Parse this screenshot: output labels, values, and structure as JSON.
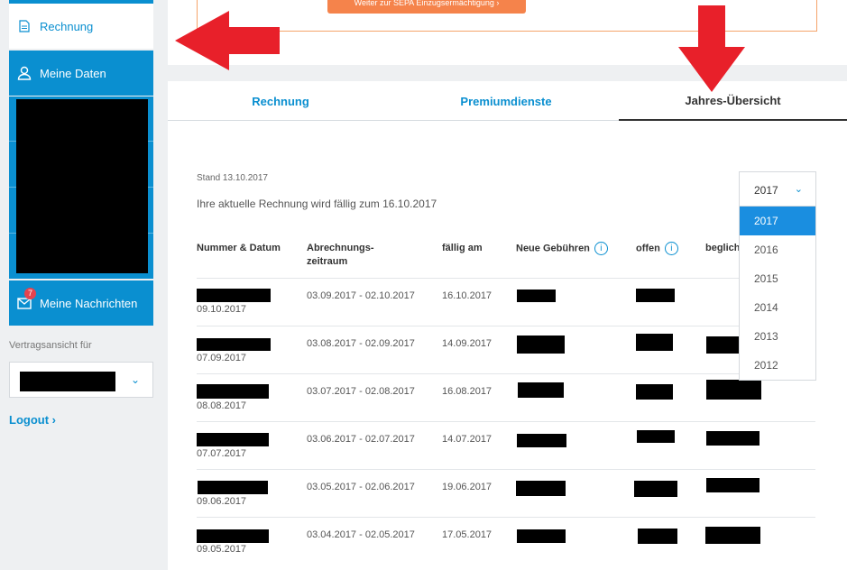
{
  "sidebar": {
    "items": [
      {
        "label": "Rechnung",
        "icon": "document-icon"
      },
      {
        "label": "Meine Daten",
        "icon": "user-icon"
      },
      {
        "label": "Meine Nachrichten",
        "icon": "envelope-icon",
        "badge": "7"
      }
    ],
    "contract_label": "Vertragsansicht für",
    "logout": "Logout ›"
  },
  "banner": {
    "button_label": "Weiter zur SEPA Einzugsermächtigung ›"
  },
  "tabs": [
    "Rechnung",
    "Premiumdienste",
    "Jahres-Übersicht"
  ],
  "main": {
    "stand": "Stand 13.10.2017",
    "due_text": "Ihre aktuelle Rechnung wird fällig zum 16.10.2017"
  },
  "table": {
    "headers": {
      "nummer": "Nummer & Datum",
      "zeitraum_1": "Abrechnungs-",
      "zeitraum_2": "zeitraum",
      "faellig": "fällig am",
      "gebuehren": "Neue Gebühren",
      "offen": "offen",
      "beglichen": "beglich"
    },
    "rows": [
      {
        "datum": "09.10.2017",
        "zeitraum": "03.09.2017 - 02.10.2017",
        "faellig": "16.10.2017"
      },
      {
        "datum": "07.09.2017",
        "zeitraum": "03.08.2017 - 02.09.2017",
        "faellig": "14.09.2017"
      },
      {
        "datum": "08.08.2017",
        "zeitraum": "03.07.2017 - 02.08.2017",
        "faellig": "16.08.2017"
      },
      {
        "datum": "07.07.2017",
        "zeitraum": "03.06.2017 - 02.07.2017",
        "faellig": "14.07.2017"
      },
      {
        "datum": "09.06.2017",
        "zeitraum": "03.05.2017 - 02.06.2017",
        "faellig": "19.06.2017"
      },
      {
        "datum": "09.05.2017",
        "zeitraum": "03.04.2017 - 02.05.2017",
        "faellig": "17.05.2017"
      }
    ]
  },
  "year_select": {
    "selected": "2017",
    "options": [
      "2017",
      "2016",
      "2015",
      "2014",
      "2013",
      "2012"
    ]
  },
  "colors": {
    "accent": "#0a8fd0",
    "orange": "#f5834b",
    "arrow": "#e8202a"
  }
}
